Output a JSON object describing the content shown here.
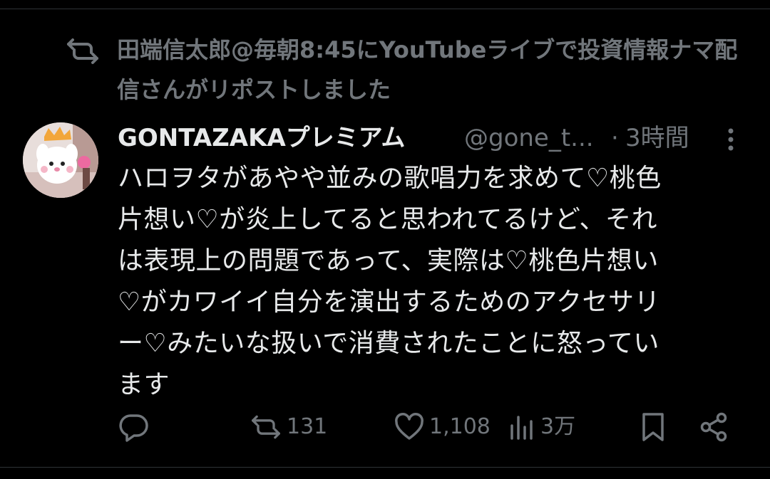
{
  "repost_context": {
    "text": "田端信太郎@毎朝8:45にYouTubeライブで投資情報ナマ配信さんがリポストしました",
    "icon": "repost-icon"
  },
  "tweet": {
    "author": {
      "display_name": "GONTAZAKAプレミアム",
      "handle": "@gone_t...",
      "avatar_icon": "avatar"
    },
    "separator": "·",
    "time": "3時間",
    "text": "ハロヲタがあやや並みの歌唱力を求めて♡桃色\n片想い♡が炎上してると思われてるけど、それ\nは表現上の問題であって、実際は♡桃色片想い\n♡がカワイイ自分を演出するためのアクセサリ\nー♡みたいな扱いで消費されたことに怒ってい\nます"
  },
  "actions": {
    "reply": {
      "icon": "reply-icon",
      "count": ""
    },
    "repost": {
      "icon": "repost-icon",
      "count": "131"
    },
    "like": {
      "icon": "heart-icon",
      "count": "1,108"
    },
    "views": {
      "icon": "views-icon",
      "count": "3万"
    },
    "bookmark": {
      "icon": "bookmark-icon"
    },
    "share": {
      "icon": "share-icon"
    }
  },
  "colors": {
    "background": "#000000",
    "primary_text": "#e7e9ea",
    "secondary_text": "#71767b",
    "divider": "#2f3336"
  }
}
